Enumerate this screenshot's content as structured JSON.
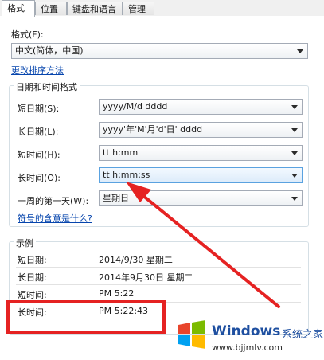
{
  "tabs": [
    "格式",
    "位置",
    "键盘和语言",
    "管理"
  ],
  "format": {
    "label": "格式(F):",
    "value": "中文(简体，中国)",
    "sort_link": "更改排序方法"
  },
  "datetime_group": {
    "title": "日期和时间格式",
    "rows": [
      {
        "label": "短日期(S):",
        "value": "yyyy/M/d dddd"
      },
      {
        "label": "长日期(L):",
        "value": "yyyy'年'M'月'd'日' dddd"
      },
      {
        "label": "短时间(H):",
        "value": "tt h:mm"
      },
      {
        "label": "长时间(O):",
        "value": "tt h:mm:ss"
      },
      {
        "label": "一周的第一天(W):",
        "value": "星期日"
      }
    ],
    "symbol_link": "符号的含意是什么?"
  },
  "example_group": {
    "title": "示例",
    "rows": [
      {
        "label": "短日期:",
        "value": "2014/9/30 星期二"
      },
      {
        "label": "长日期:",
        "value": "2014年9月30日 星期二"
      },
      {
        "label": "短时间:",
        "value": "PM 5:22"
      },
      {
        "label": "长时间:",
        "value": "PM 5:22:43"
      }
    ]
  },
  "watermark": {
    "brand": "Windows",
    "cn": "系统之家",
    "url": "www.bjjmlv.com"
  },
  "colors": {
    "annotation": "#e52222",
    "link": "#0645ad",
    "focus_border": "#5aa2e0"
  }
}
